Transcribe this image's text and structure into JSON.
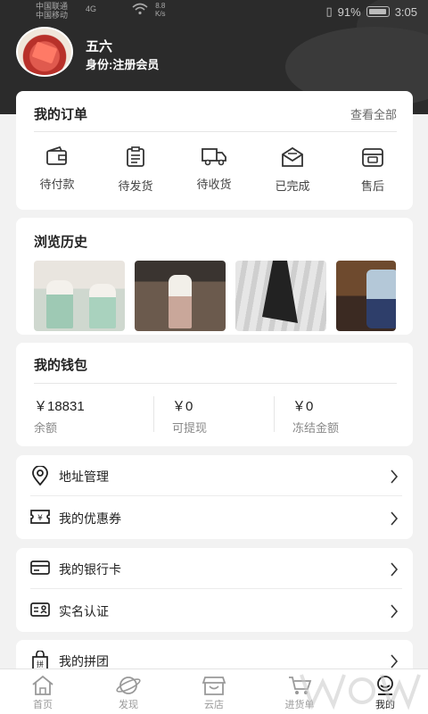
{
  "status_bar": {
    "carrier1": "中国联通",
    "carrier2": "中国移动",
    "signal": "4G",
    "speed_value": "8.8",
    "speed_unit": "K/s",
    "battery": "91%",
    "time": "3:05"
  },
  "profile": {
    "name": "五六",
    "role": "身份:注册会员"
  },
  "orders": {
    "title": "我的订单",
    "view_all": "查看全部",
    "items": [
      {
        "label": "待付款",
        "icon": "wallet-icon"
      },
      {
        "label": "待发货",
        "icon": "clipboard-icon"
      },
      {
        "label": "待收货",
        "icon": "truck-icon"
      },
      {
        "label": "已完成",
        "icon": "envelope-icon"
      },
      {
        "label": "售后",
        "icon": "service-box-icon"
      }
    ]
  },
  "history": {
    "title": "浏览历史"
  },
  "wallet": {
    "title": "我的钱包",
    "items": [
      {
        "value": "￥18831",
        "label": "余额"
      },
      {
        "value": "￥0",
        "label": "可提现"
      },
      {
        "value": "￥0",
        "label": "冻结金额"
      }
    ]
  },
  "menu": {
    "address": "地址管理",
    "coupons": "我的优惠券",
    "bank_card": "我的银行卡",
    "verify": "实名认证",
    "group_buy": "我的拼团"
  },
  "tabs": [
    {
      "label": "首页",
      "icon": "home-icon"
    },
    {
      "label": "发现",
      "icon": "planet-icon"
    },
    {
      "label": "云店",
      "icon": "store-icon"
    },
    {
      "label": "进货单",
      "icon": "cart-icon"
    },
    {
      "label": "我的",
      "icon": "user-icon"
    }
  ],
  "colors": {
    "header_bg": "#2b2b2b",
    "page_bg": "#f2f2f2",
    "card_bg": "#ffffff"
  }
}
